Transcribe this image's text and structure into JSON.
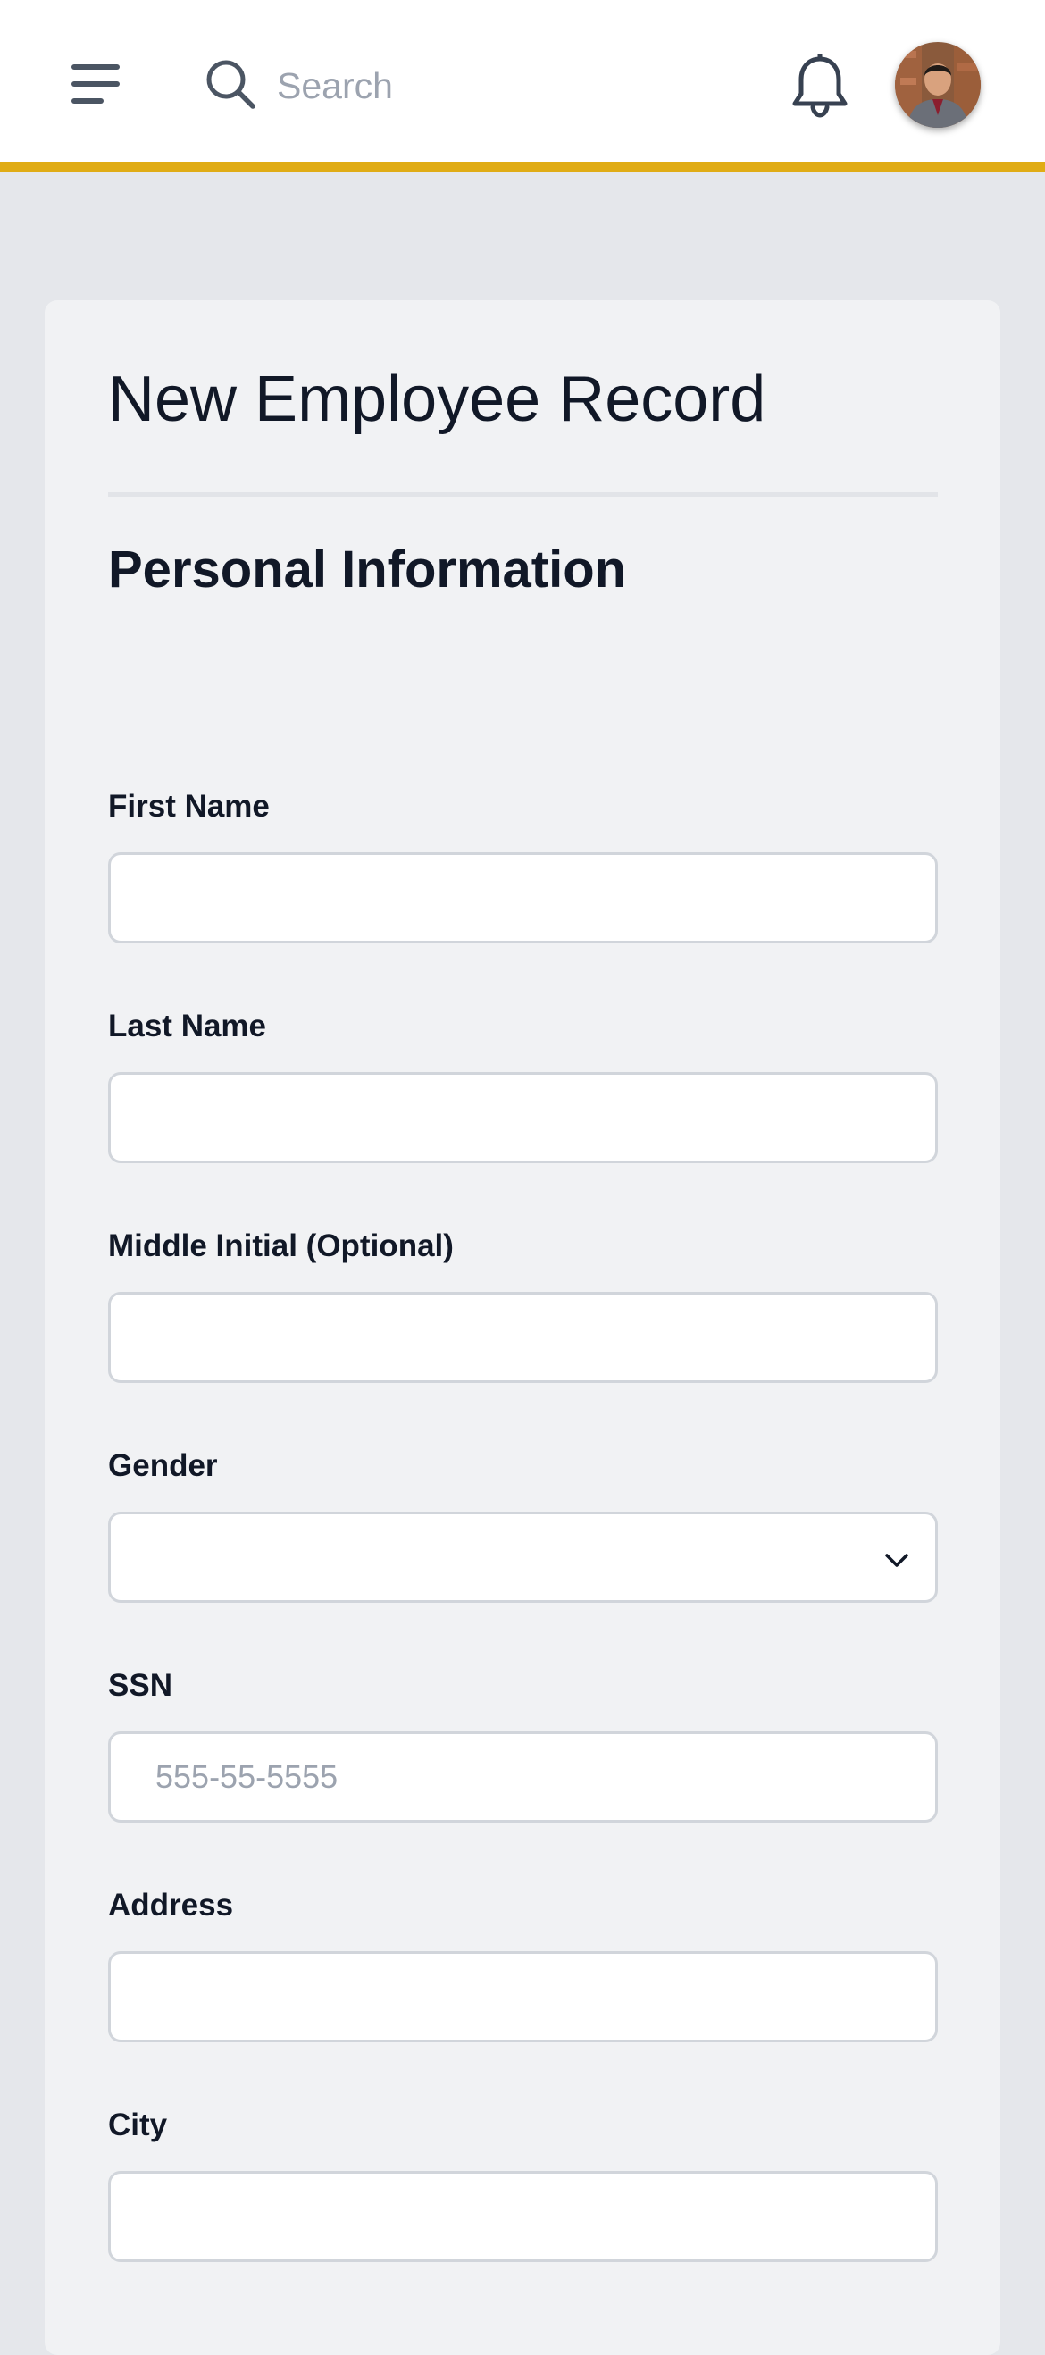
{
  "header": {
    "menu_icon": "hamburger-menu-icon",
    "search": {
      "icon": "search-icon",
      "placeholder": "Search",
      "value": ""
    },
    "notifications_icon": "bell-icon",
    "avatar_alt": "user-avatar",
    "accent_color": "#e0ac15"
  },
  "page": {
    "title": "New Employee Record",
    "section_title": "Personal Information"
  },
  "form": {
    "first_name": {
      "label": "First Name",
      "value": "",
      "placeholder": ""
    },
    "last_name": {
      "label": "Last Name",
      "value": "",
      "placeholder": ""
    },
    "middle_initial": {
      "label": "Middle Initial (Optional)",
      "value": "",
      "placeholder": ""
    },
    "gender": {
      "label": "Gender",
      "selected": "",
      "icon": "chevron-down-icon"
    },
    "ssn": {
      "label": "SSN",
      "value": "",
      "placeholder": "555-55-5555"
    },
    "address": {
      "label": "Address",
      "value": "",
      "placeholder": ""
    },
    "city": {
      "label": "City",
      "value": "",
      "placeholder": ""
    }
  }
}
